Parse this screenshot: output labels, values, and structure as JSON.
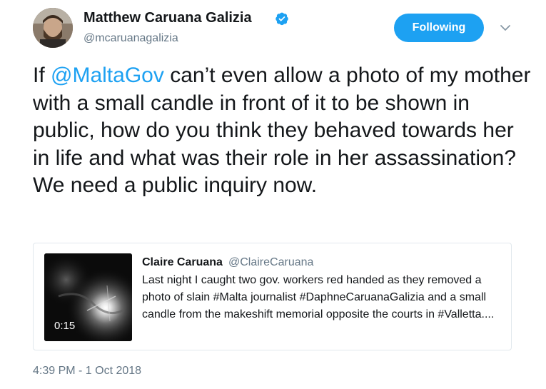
{
  "author": {
    "name": "Matthew Caruana Galizia",
    "handle": "@mcaruanagalizia",
    "verified": true
  },
  "follow_button": {
    "label": "Following"
  },
  "tweet": {
    "prefix": "If ",
    "mention": "@MaltaGov",
    "body": " can’t even allow a photo of my mother with a small candle in front of it to be shown in public, how do you think they behaved towards her in life and what was their role in her assassination? We need a public inquiry now.",
    "timestamp": "4:39 PM - 1 Oct 2018"
  },
  "quoted_tweet": {
    "name": "Claire Caruana",
    "handle": "@ClaireCaruana",
    "text": "Last night I caught two gov. workers red handed as they removed a photo of slain #Malta journalist #DaphneCaruanaGalizia and a small candle from the makeshift memorial opposite the courts in #Valletta....",
    "video_duration": "0:15"
  },
  "colors": {
    "accent": "#1da1f2",
    "text": "#14171a",
    "secondary_text": "#657786",
    "border": "#e1e8ed"
  },
  "icons": {
    "verified": "verified-badge-icon",
    "caret": "chevron-down-icon"
  }
}
